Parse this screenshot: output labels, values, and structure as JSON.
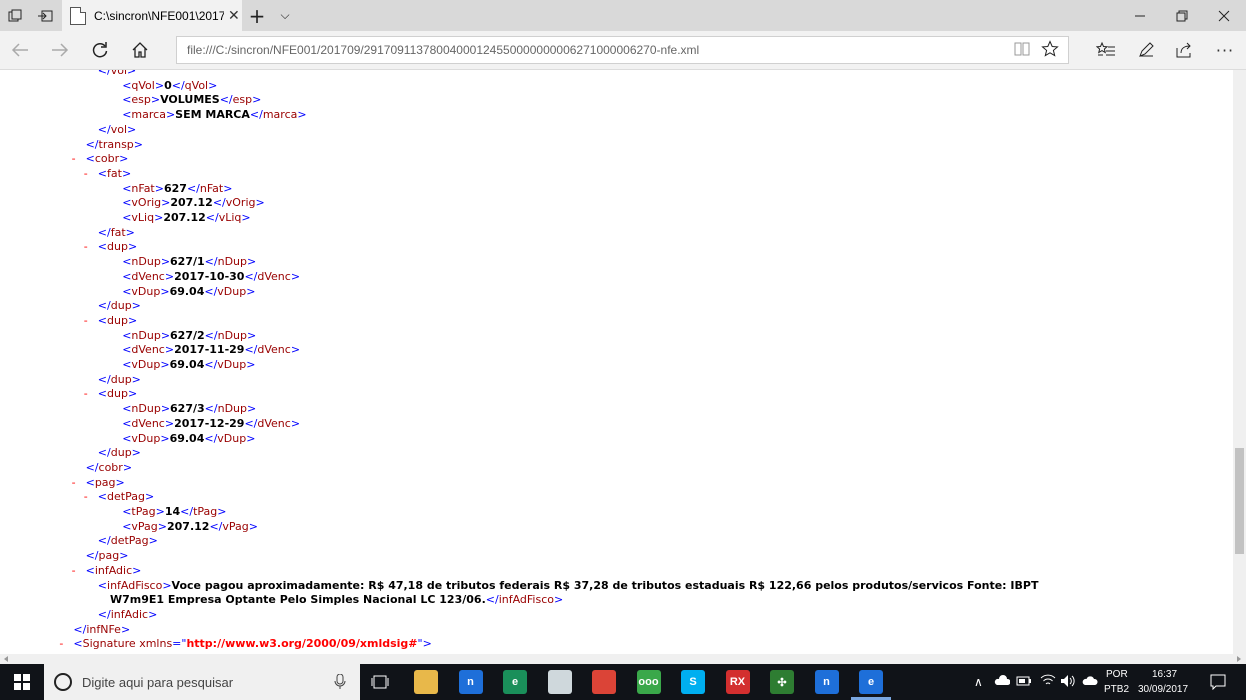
{
  "browser": {
    "tab_title": "C:\\sincron\\NFE001\\2017",
    "address": "file:///C:/sincron/NFE001/201709/29170911378004000124550000000006271000006270-nfe.xml",
    "new_tab": "+",
    "tab_list": "⌵"
  },
  "xml_lines": [
    {
      "indent": 4,
      "type": "close",
      "tag": "vol",
      "partial": true
    },
    {
      "indent": 6,
      "type": "elem",
      "tag": "qVol",
      "value": "0"
    },
    {
      "indent": 6,
      "type": "elem",
      "tag": "esp",
      "value": "VOLUMES"
    },
    {
      "indent": 6,
      "type": "elem",
      "tag": "marca",
      "value": "SEM MARCA"
    },
    {
      "indent": 4,
      "type": "close",
      "tag": "vol"
    },
    {
      "indent": 3,
      "type": "close",
      "tag": "transp"
    },
    {
      "indent": 3,
      "type": "open",
      "tag": "cobr",
      "collapse": "-"
    },
    {
      "indent": 4,
      "type": "open",
      "tag": "fat",
      "collapse": "-"
    },
    {
      "indent": 6,
      "type": "elem",
      "tag": "nFat",
      "value": "627"
    },
    {
      "indent": 6,
      "type": "elem",
      "tag": "vOrig",
      "value": "207.12"
    },
    {
      "indent": 6,
      "type": "elem",
      "tag": "vLiq",
      "value": "207.12"
    },
    {
      "indent": 4,
      "type": "close",
      "tag": "fat"
    },
    {
      "indent": 4,
      "type": "open",
      "tag": "dup",
      "collapse": "-"
    },
    {
      "indent": 6,
      "type": "elem",
      "tag": "nDup",
      "value": "627/1"
    },
    {
      "indent": 6,
      "type": "elem",
      "tag": "dVenc",
      "value": "2017-10-30"
    },
    {
      "indent": 6,
      "type": "elem",
      "tag": "vDup",
      "value": "69.04"
    },
    {
      "indent": 4,
      "type": "close",
      "tag": "dup"
    },
    {
      "indent": 4,
      "type": "open",
      "tag": "dup",
      "collapse": "-"
    },
    {
      "indent": 6,
      "type": "elem",
      "tag": "nDup",
      "value": "627/2"
    },
    {
      "indent": 6,
      "type": "elem",
      "tag": "dVenc",
      "value": "2017-11-29"
    },
    {
      "indent": 6,
      "type": "elem",
      "tag": "vDup",
      "value": "69.04"
    },
    {
      "indent": 4,
      "type": "close",
      "tag": "dup"
    },
    {
      "indent": 4,
      "type": "open",
      "tag": "dup",
      "collapse": "-"
    },
    {
      "indent": 6,
      "type": "elem",
      "tag": "nDup",
      "value": "627/3"
    },
    {
      "indent": 6,
      "type": "elem",
      "tag": "dVenc",
      "value": "2017-12-29"
    },
    {
      "indent": 6,
      "type": "elem",
      "tag": "vDup",
      "value": "69.04"
    },
    {
      "indent": 4,
      "type": "close",
      "tag": "dup"
    },
    {
      "indent": 3,
      "type": "close",
      "tag": "cobr"
    },
    {
      "indent": 3,
      "type": "open",
      "tag": "pag",
      "collapse": "-"
    },
    {
      "indent": 4,
      "type": "open",
      "tag": "detPag",
      "collapse": "-"
    },
    {
      "indent": 6,
      "type": "elem",
      "tag": "tPag",
      "value": "14"
    },
    {
      "indent": 6,
      "type": "elem",
      "tag": "vPag",
      "value": "207.12"
    },
    {
      "indent": 4,
      "type": "close",
      "tag": "detPag"
    },
    {
      "indent": 3,
      "type": "close",
      "tag": "pag"
    },
    {
      "indent": 3,
      "type": "open",
      "tag": "infAdic",
      "collapse": "-"
    },
    {
      "indent": 4,
      "type": "elemstart",
      "tag": "infAdFisco",
      "value": "Voce pagou aproximadamente: R$ 47,18 de tributos federais R$ 37,28 de tributos estaduais R$ 122,66 pelos produtos/servicos Fonte: IBPT"
    },
    {
      "indent": 5,
      "type": "elemend",
      "tag": "infAdFisco",
      "value": "W7m9E1 Empresa Optante Pelo Simples Nacional LC 123/06."
    },
    {
      "indent": 4,
      "type": "close",
      "tag": "infAdic"
    },
    {
      "indent": 2,
      "type": "close",
      "tag": "infNFe"
    },
    {
      "indent": 2,
      "type": "attr",
      "tag": "Signature",
      "collapse": "-",
      "attr": "xmlns",
      "attr_value": "http://www.w3.org/2000/09/xmldsig#"
    }
  ],
  "taskbar": {
    "search_placeholder": "Digite aqui para pesquisar",
    "lang_top": "POR",
    "lang_bottom": "PTB2",
    "time": "16:37",
    "date": "30/09/2017",
    "icons": [
      {
        "name": "file-explorer-icon",
        "color": "#e8b84a",
        "label": ""
      },
      {
        "name": "app-blue-icon",
        "color": "#1e6fd9",
        "label": "n"
      },
      {
        "name": "edge-colored-icon",
        "color": "#1a8f5a",
        "label": "e"
      },
      {
        "name": "notepad-icon",
        "color": "#cfd8dc",
        "label": ""
      },
      {
        "name": "chrome-icon",
        "color": "#db4437",
        "label": ""
      },
      {
        "name": "green-app-icon",
        "color": "#3aa84a",
        "label": "ooo"
      },
      {
        "name": "skype-icon",
        "color": "#00aff0",
        "label": "S"
      },
      {
        "name": "rx-icon",
        "color": "#d32f2f",
        "label": "RX"
      },
      {
        "name": "dots-app-icon",
        "color": "#2e7d32",
        "label": "✣"
      },
      {
        "name": "app-blue2-icon",
        "color": "#1e6fd9",
        "label": "n"
      },
      {
        "name": "edge-icon",
        "color": "#1e6fd9",
        "label": "e"
      }
    ]
  }
}
